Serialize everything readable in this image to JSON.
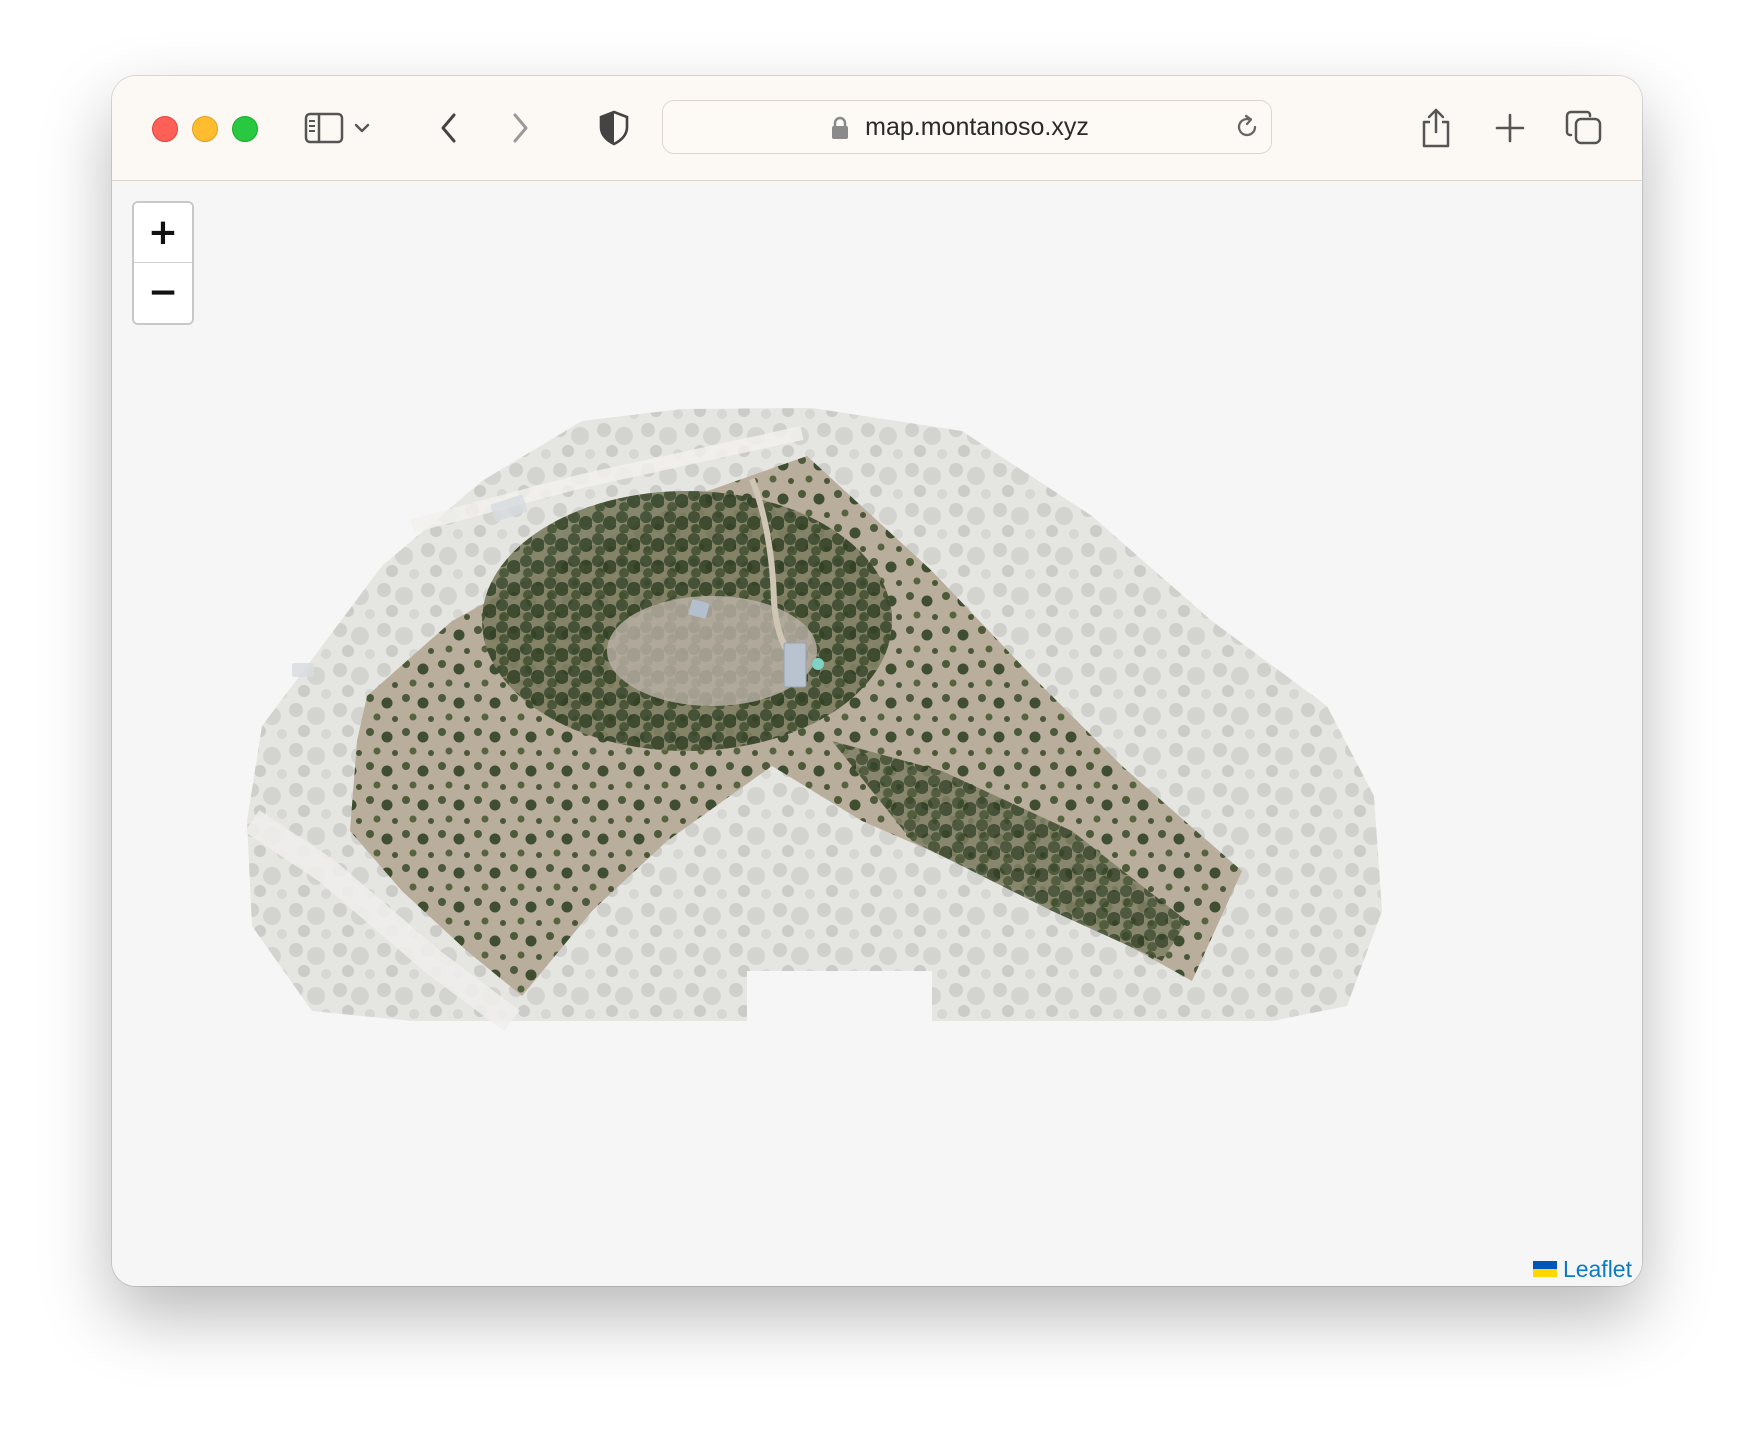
{
  "browser": {
    "url": "map.montanoso.xyz",
    "icons": [
      "sidebar-icon",
      "chevron-down-icon",
      "back-icon",
      "forward-icon",
      "shield-icon",
      "lock-icon",
      "reload-icon",
      "share-icon",
      "new-tab-icon",
      "tabs-overview-icon"
    ]
  },
  "map": {
    "zoom_in_label": "+",
    "zoom_out_label": "−",
    "attribution": "Leaflet"
  }
}
